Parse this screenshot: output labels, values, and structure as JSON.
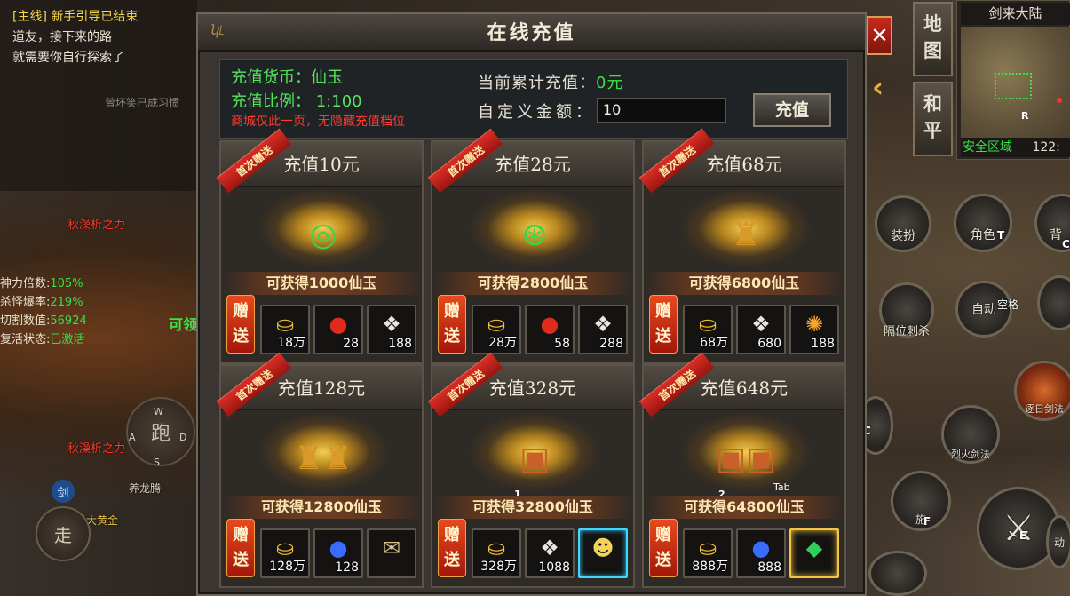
{
  "quest": {
    "tag": "[主线]",
    "status": "新手引导已结束",
    "line1": "道友，接下来的路",
    "line2": "就需要你自行探索了"
  },
  "world_text": {
    "faded_notice": "曾坏笑已成习惯",
    "red_name_1": "秋澡析之力",
    "red_name_2": "秋澡析之力",
    "green_label": "可领",
    "char_name": "养龙腾",
    "char_name_2": "忌大黄金"
  },
  "stats": [
    {
      "label": "神力倍数:",
      "value": "105%"
    },
    {
      "label": "杀怪爆率:",
      "value": "219%"
    },
    {
      "label": "切割数值:",
      "value": "56924"
    },
    {
      "label": "复活状态:",
      "value": "已激活"
    }
  ],
  "joystick": {
    "center": "跑",
    "w": "W",
    "a": "A",
    "s": "S",
    "d": "D",
    "walk": "走",
    "sword": "剑"
  },
  "right_ui": {
    "map_btn": "地图",
    "peace_btn": "和平",
    "minimap_title": "剑来大陆",
    "zone": "安全区域",
    "coord": "122:",
    "r_marker": "R"
  },
  "skills": [
    {
      "label": "装扮",
      "key": ""
    },
    {
      "label": "角色",
      "key": "T"
    },
    {
      "label": "背",
      "key": "C"
    },
    {
      "label": "隔位刺杀",
      "key": ""
    },
    {
      "label": "自动",
      "key": "空格"
    },
    {
      "label": "逐日剑法",
      "key": ""
    },
    {
      "label": "烈火剑法",
      "key": ""
    },
    {
      "label": "施",
      "key": "F"
    },
    {
      "label": "",
      "key": "E"
    },
    {
      "label": "",
      "key": "C"
    },
    {
      "label": "动",
      "key": ""
    }
  ],
  "panel": {
    "title": "在线充值",
    "close": "✕",
    "currency_label": "充值货币：仙玉",
    "ratio_label": "充值比例：  1:100",
    "warning": "商城仅此一页，无隐藏充值档位",
    "total_label": "当前累计充值：",
    "total_value": "0元",
    "custom_label": "自定义金额：",
    "amount_value": "10",
    "pay_button": "充值"
  },
  "ribbon_text": "首次赠送",
  "gift_text": "赠送",
  "tiers": [
    {
      "title": "充值10元",
      "gain": "可获得1000仙玉",
      "icon": "jade-ring-icon",
      "items": [
        {
          "icon": "gold-ingot-icon",
          "count": "18万"
        },
        {
          "icon": "red-orb-icon",
          "count": "28"
        },
        {
          "icon": "white-crystal-icon",
          "count": "188"
        }
      ]
    },
    {
      "title": "充值28元",
      "gain": "可获得2800仙玉",
      "icon": "jade-rings-icon",
      "items": [
        {
          "icon": "gold-ingot-icon",
          "count": "28万"
        },
        {
          "icon": "red-orb-icon",
          "count": "58"
        },
        {
          "icon": "white-crystal-icon",
          "count": "288"
        }
      ]
    },
    {
      "title": "充值68元",
      "gain": "可获得6800仙玉",
      "icon": "money-bag-icon",
      "items": [
        {
          "icon": "gold-ingot-icon",
          "count": "68万"
        },
        {
          "icon": "white-crystal-icon",
          "count": "680"
        },
        {
          "icon": "lightning-orb-icon",
          "count": "188"
        }
      ]
    },
    {
      "title": "充值128元",
      "gain": "可获得12800仙玉",
      "icon": "money-bags-icon",
      "items": [
        {
          "icon": "gold-ingot-icon",
          "count": "128万"
        },
        {
          "icon": "blue-orb-icon",
          "count": "128"
        },
        {
          "icon": "scroll-icon",
          "count": ""
        }
      ]
    },
    {
      "title": "充值328元",
      "gain": "可获得32800仙玉",
      "icon": "treasure-chest-icon",
      "items": [
        {
          "icon": "gold-ingot-icon",
          "count": "328万"
        },
        {
          "icon": "white-crystal-icon",
          "count": "1088"
        },
        {
          "icon": "avatar-card-icon",
          "count": ""
        }
      ]
    },
    {
      "title": "充值648元",
      "gain": "可获得64800仙玉",
      "icon": "treasure-chests-icon",
      "items": [
        {
          "icon": "gold-ingot-icon",
          "count": "888万"
        },
        {
          "icon": "blue-orb-icon",
          "count": "888"
        },
        {
          "icon": "green-gem-icon",
          "count": ""
        }
      ]
    }
  ],
  "hotkey_labels": {
    "n1": "1",
    "n2": "2",
    "tab": "Tab"
  }
}
